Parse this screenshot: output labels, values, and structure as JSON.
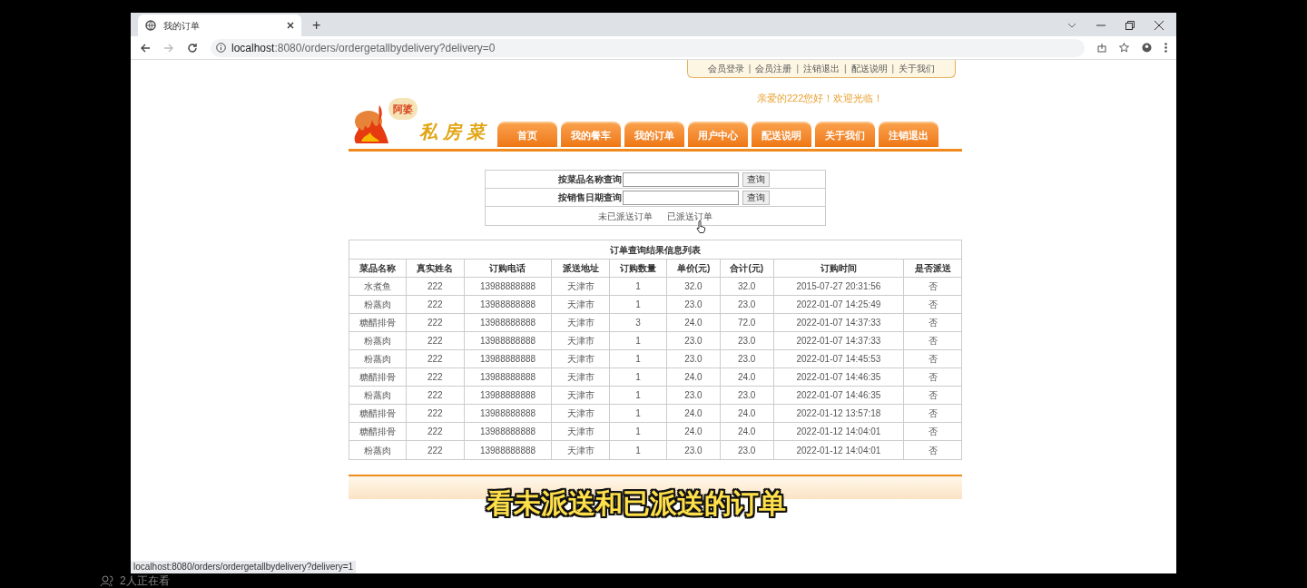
{
  "browser": {
    "tab_title": "我的订单",
    "new_tab": "+",
    "url_host": "localhost",
    "url_rest": ":8080/orders/ordergetallbydelivery?delivery=0",
    "status_url": "localhost:8080/orders/ordergetallbydelivery?delivery=1"
  },
  "top_links": [
    "会员登录",
    "会员注册",
    "注销退出",
    "配送说明",
    "关于我们"
  ],
  "top_link_separators": [
    "|",
    "|",
    "|",
    "|"
  ],
  "logo": {
    "badge": "阿婆",
    "name": "私房菜"
  },
  "greeting": "亲爱的222您好！欢迎光临！",
  "nav": [
    "首页",
    "我的餐车",
    "我的订单",
    "用户中心",
    "配送说明",
    "关于我们",
    "注销退出"
  ],
  "search": {
    "rows": [
      {
        "label": "按菜品名称查询",
        "button": "查询"
      },
      {
        "label": "按销售日期查询",
        "button": "查询"
      }
    ],
    "links": [
      "未已派送订单",
      "已派送订单"
    ]
  },
  "table": {
    "caption": "订单查询结果信息列表",
    "columns": [
      "菜品名称",
      "真实姓名",
      "订购电话",
      "派送地址",
      "订购数量",
      "单价(元)",
      "合计(元)",
      "订购时间",
      "是否派送"
    ],
    "rows": [
      [
        "水煮鱼",
        "222",
        "13988888888",
        "天津市",
        "1",
        "32.0",
        "32.0",
        "2015-07-27 20:31:56",
        "否"
      ],
      [
        "粉蒸肉",
        "222",
        "13988888888",
        "天津市",
        "1",
        "23.0",
        "23.0",
        "2022-01-07 14:25:49",
        "否"
      ],
      [
        "糖醋排骨",
        "222",
        "13988888888",
        "天津市",
        "3",
        "24.0",
        "72.0",
        "2022-01-07 14:37:33",
        "否"
      ],
      [
        "粉蒸肉",
        "222",
        "13988888888",
        "天津市",
        "1",
        "23.0",
        "23.0",
        "2022-01-07 14:37:33",
        "否"
      ],
      [
        "粉蒸肉",
        "222",
        "13988888888",
        "天津市",
        "1",
        "23.0",
        "23.0",
        "2022-01-07 14:45:53",
        "否"
      ],
      [
        "糖醋排骨",
        "222",
        "13988888888",
        "天津市",
        "1",
        "24.0",
        "24.0",
        "2022-01-07 14:46:35",
        "否"
      ],
      [
        "粉蒸肉",
        "222",
        "13988888888",
        "天津市",
        "1",
        "23.0",
        "23.0",
        "2022-01-07 14:46:35",
        "否"
      ],
      [
        "糖醋排骨",
        "222",
        "13988888888",
        "天津市",
        "1",
        "24.0",
        "24.0",
        "2022-01-12 13:57:18",
        "否"
      ],
      [
        "糖醋排骨",
        "222",
        "13988888888",
        "天津市",
        "1",
        "24.0",
        "24.0",
        "2022-01-12 14:04:01",
        "否"
      ],
      [
        "粉蒸肉",
        "222",
        "13988888888",
        "天津市",
        "1",
        "23.0",
        "23.0",
        "2022-01-12 14:04:01",
        "否"
      ]
    ]
  },
  "subtitle": "看未派送和已派送的订单",
  "viewer_count": "2人正在看"
}
